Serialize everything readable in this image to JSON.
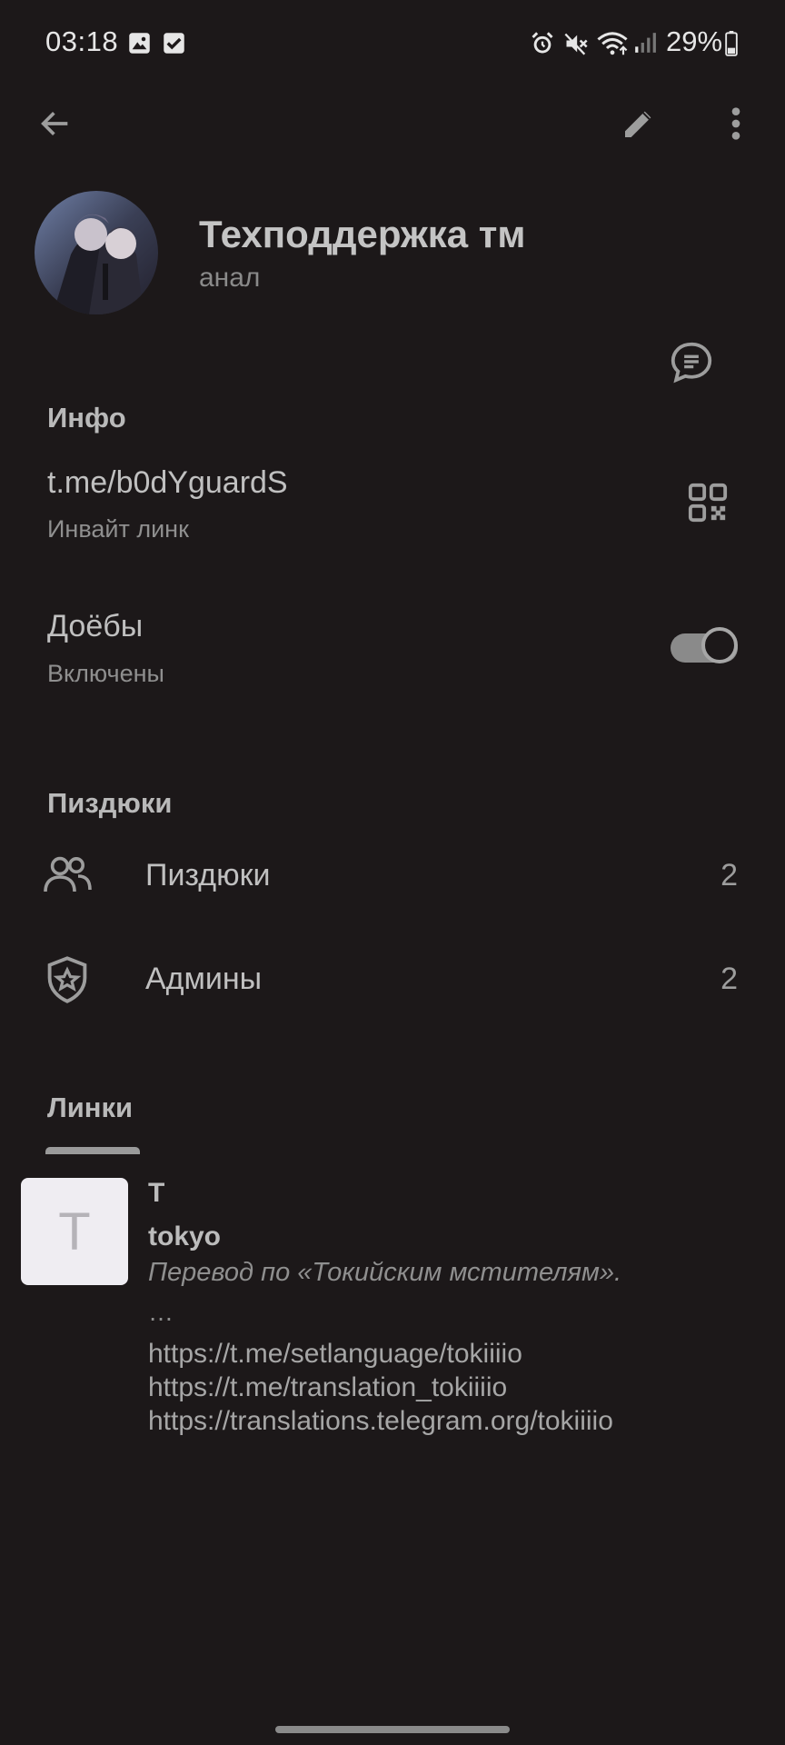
{
  "status_bar": {
    "time": "03:18",
    "battery_percent": "29%",
    "left_icons": [
      "gallery-icon",
      "check-box-icon"
    ],
    "right_icons": [
      "alarm-icon",
      "mute-icon",
      "wifi-icon",
      "signal-icon",
      "battery-icon"
    ]
  },
  "toolbar": {
    "back_icon": "arrow-back-icon",
    "edit_icon": "pencil-icon",
    "more_icon": "more-vertical-icon"
  },
  "channel": {
    "name": "Техподдержка тм",
    "subtitle": "анал"
  },
  "info": {
    "section_title": "Инфо",
    "invite_link": "t.me/b0dYguardS",
    "invite_link_label": "Инвайт линк",
    "toggle_title": "Доёбы",
    "toggle_status": "Включены",
    "toggle_on": true
  },
  "members": {
    "section_title": "Пиздюки",
    "items": [
      {
        "label": "Пиздюки",
        "count": "2",
        "icon": "people-icon"
      },
      {
        "label": "Админы",
        "count": "2",
        "icon": "admin-shield-icon"
      }
    ]
  },
  "links": {
    "tab_title": "Линки",
    "item": {
      "thumb_letter": "T",
      "letter": "T",
      "title": "tokyo",
      "description": "Перевод по «Токийским мстителям».",
      "ellipsis": "…",
      "urls": [
        "https://t.me/setlanguage/tokiiiio",
        "https://t.me/translation_tokiiiio",
        "https://translations.telegram.org/tokiiiio"
      ]
    }
  },
  "colors": {
    "background": "#1c1819",
    "text_primary": "#c0c0c0",
    "text_secondary": "#8f8f8f",
    "toggle_track": "#8a8a8a"
  }
}
